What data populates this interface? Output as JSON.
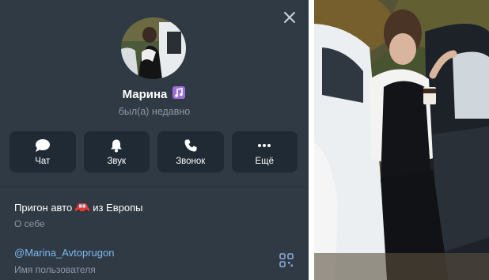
{
  "profile": {
    "name": "Марина",
    "status": "был(а) недавно"
  },
  "actions": [
    {
      "label": "Чат",
      "icon": "chat-icon"
    },
    {
      "label": "Звук",
      "icon": "bell-icon"
    },
    {
      "label": "Звонок",
      "icon": "phone-icon"
    },
    {
      "label": "Ещё",
      "icon": "more-icon"
    }
  ],
  "info": {
    "about_value_before": "Пригон авто",
    "about_value_after": "из Европы",
    "about_label": "О себе",
    "username_value": "@Marina_Avtoprugon",
    "username_label": "Имя пользователя"
  },
  "colors": {
    "panel_bg": "#2f3a45",
    "button_bg": "#202a34",
    "secondary_text": "#8b98a6",
    "link": "#7fb8ef",
    "accent": "#6fa9e6"
  }
}
